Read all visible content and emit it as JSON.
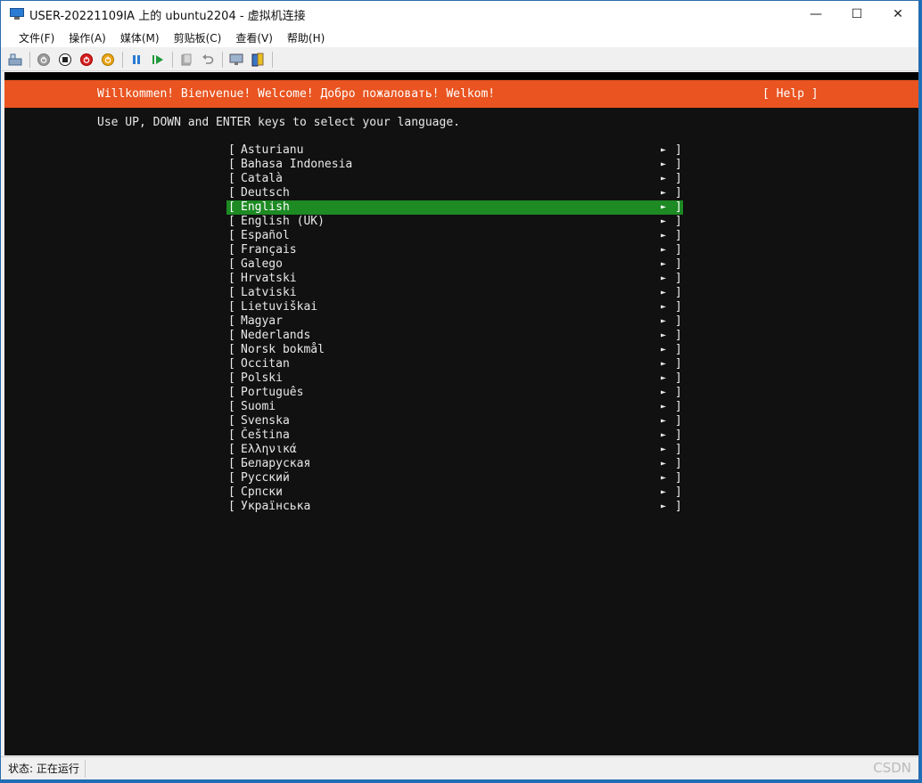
{
  "window": {
    "title": "USER-20221109IA 上的 ubuntu2204 - 虚拟机连接",
    "controls": {
      "minimize": "—",
      "maximize": "☐",
      "close": "✕"
    }
  },
  "menu": [
    "文件(F)",
    "操作(A)",
    "媒体(M)",
    "剪贴板(C)",
    "查看(V)",
    "帮助(H)"
  ],
  "installer": {
    "header": "Willkommen! Bienvenue! Welcome! Добро пожаловать! Welkom!",
    "help": "[ Help ]",
    "instruction": "Use UP, DOWN and ENTER keys to select your language.",
    "selected_index": 4,
    "languages": [
      "Asturianu",
      "Bahasa Indonesia",
      "Català",
      "Deutsch",
      "English",
      "English (UK)",
      "Español",
      "Français",
      "Galego",
      "Hrvatski",
      "Latviski",
      "Lietuviškai",
      "Magyar",
      "Nederlands",
      "Norsk bokmål",
      "Occitan",
      "Polski",
      "Português",
      "Suomi",
      "Svenska",
      "Čeština",
      "Ελληνικά",
      "Беларуская",
      "Русский",
      "Српски",
      "Українська"
    ],
    "colors": {
      "header_bg": "#e95420",
      "selected_bg": "#1d8a24",
      "screen_bg": "#111111"
    }
  },
  "status": {
    "text": "状态: 正在运行",
    "watermark": "CSDN"
  }
}
